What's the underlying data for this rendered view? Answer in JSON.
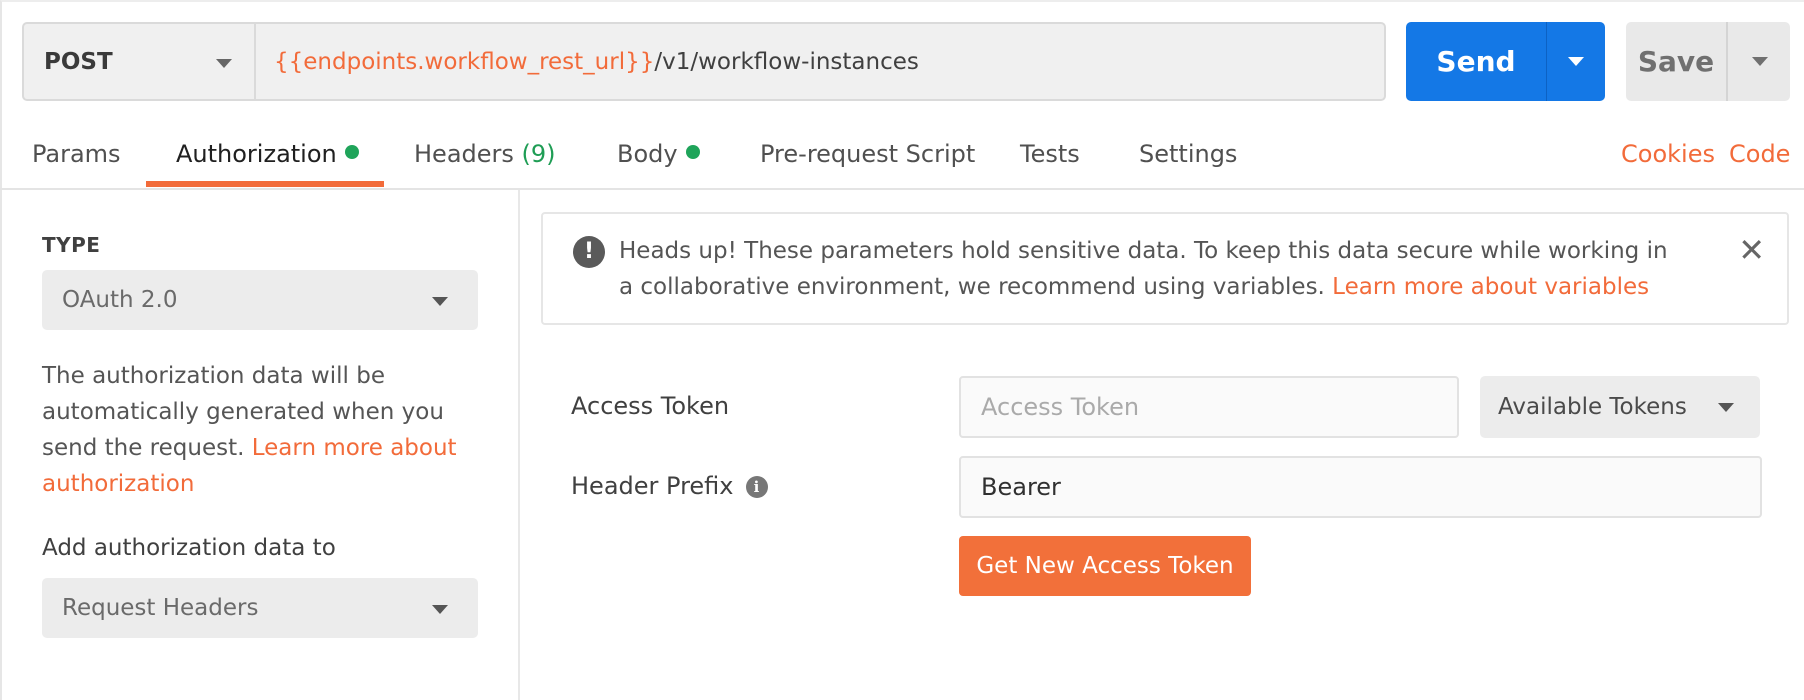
{
  "request": {
    "method": "POST",
    "url_variable": "{{endpoints.workflow_rest_url}}",
    "url_path": "/v1/workflow-instances",
    "send_label": "Send",
    "save_label": "Save"
  },
  "tabs": {
    "params": "Params",
    "authorization": "Authorization",
    "headers": "Headers",
    "headers_count": "(9)",
    "body": "Body",
    "prerequest": "Pre-request Script",
    "tests": "Tests",
    "settings": "Settings",
    "cookies": "Cookies",
    "code": "Code"
  },
  "auth": {
    "type_label": "TYPE",
    "type_value": "OAuth 2.0",
    "description": "The authorization data will be automatically generated when you send the request.",
    "learn_more": "Learn more about authorization",
    "add_to_label": "Add authorization data to",
    "add_to_value": "Request Headers"
  },
  "notice": {
    "text": "Heads up! These parameters hold sensitive data. To keep this data secure while working in a collaborative environment, we recommend using variables.",
    "link": "Learn more about variables",
    "icon_glyph": "!",
    "close_glyph": "✕"
  },
  "fields": {
    "access_token_label": "Access Token",
    "access_token_placeholder": "Access Token",
    "available_tokens": "Available Tokens",
    "header_prefix_label": "Header Prefix",
    "header_prefix_value": "Bearer",
    "info_glyph": "i",
    "get_token_button": "Get New Access Token"
  },
  "colors": {
    "accent": "#f26b3a",
    "send_blue": "#1478e6",
    "status_green": "#1fa45a"
  }
}
